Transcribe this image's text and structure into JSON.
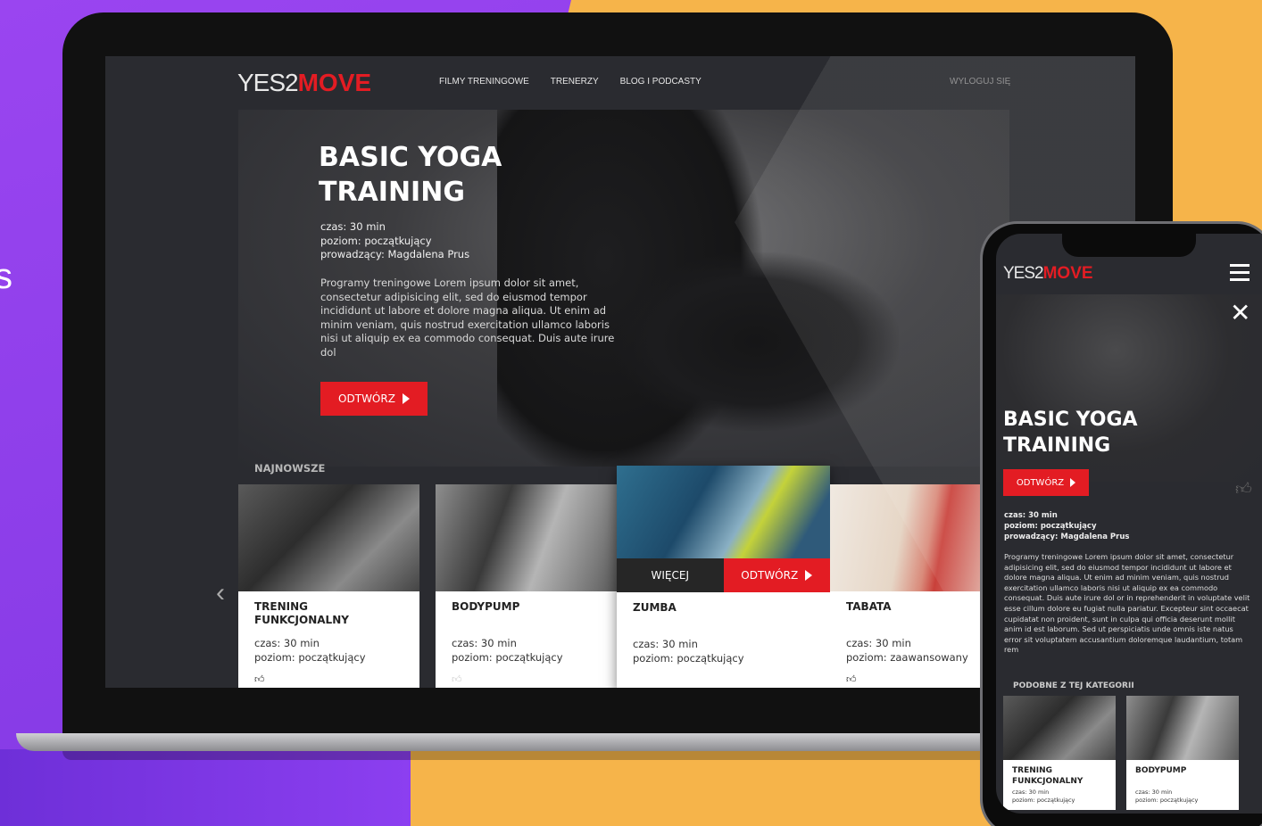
{
  "edge_letter": "s",
  "desktop": {
    "logo": {
      "main": "YES2",
      "accent": "MOVE"
    },
    "nav": [
      "FILMY TRENINGOWE",
      "TRENERZY",
      "BLOG I PODCASTY"
    ],
    "logout": "WYLOGUJ SIĘ",
    "hero": {
      "title_line1": "BASIC YOGA",
      "title_line2": "TRAINING",
      "meta": [
        "czas: 30 min",
        "poziom: początkujący",
        "prowadzący: Magdalena Prus"
      ],
      "description": "Programy treningowe Lorem ipsum dolor sit amet, consectetur adipisicing elit, sed do eiusmod tempor incididunt ut labore et dolore magna aliqua. Ut enim ad minim veniam, quis nostrud exercitation ullamco laboris nisi ut aliquip ex ea commodo consequat. Duis aute irure dol",
      "play_label": "ODTWÓRZ"
    },
    "section_label": "NAJNOWSZE",
    "cards": [
      {
        "title_line1": "TRENING",
        "title_line2": "FUNKCJONALNY",
        "time": "czas: 30 min",
        "level": "poziom: początkujący"
      },
      {
        "title_line1": "BODYPUMP",
        "title_line2": "",
        "time": "czas: 30 min",
        "level": "poziom: początkujący"
      },
      {
        "title_line1": "ZUMBA",
        "title_line2": "",
        "time": "czas: 30 min",
        "level": "poziom: początkujący",
        "more_label": "WIĘCEJ",
        "play_label": "ODTWÓRZ"
      },
      {
        "title_line1": "TABATA",
        "title_line2": "",
        "time": "czas: 30 min",
        "level": "poziom: zaawansowany"
      }
    ]
  },
  "mobile": {
    "logo": {
      "main": "YES2",
      "accent": "MOVE"
    },
    "hero": {
      "title_line1": "BASIC YOGA",
      "title_line2": "TRAINING",
      "play_label": "ODTWÓRZ",
      "meta": [
        "czas: 30 min",
        "poziom: początkujący",
        "prowadzący: Magdalena Prus"
      ],
      "description": "Programy treningowe Lorem ipsum dolor sit amet, consectetur adipisicing elit, sed do eiusmod tempor incididunt ut labore et dolore magna aliqua. Ut enim ad minim veniam, quis nostrud exercitation ullamco laboris nisi ut aliquip ex ea commodo consequat. Duis aute irure dol or in reprehenderit in voluptate velit esse cillum dolore eu fugiat nulla pariatur. Excepteur sint occaecat cupidatat non proident, sunt in culpa qui officia deserunt mollit anim id est laborum. Sed ut perspiciatis unde omnis iste natus error sit voluptatem accusantium doloremque laudantium, totam rem"
    },
    "section_label": "PODOBNE Z TEJ KATEGORII",
    "cards": [
      {
        "title_line1": "TRENING",
        "title_line2": "FUNKCJONALNY",
        "time": "czas: 30 min",
        "level": "poziom: początkujący"
      },
      {
        "title_line1": "BODYPUMP",
        "title_line2": "",
        "time": "czas: 30 min",
        "level": "poziom: początkujący"
      }
    ]
  },
  "colors": {
    "accent": "#e31c23",
    "purple": "#8c3ff0",
    "orange": "#f6b44a",
    "screen_bg": "#2a2b30"
  },
  "icons": [
    "play-icon",
    "chevron-left-icon",
    "thumbs-up-icon",
    "menu-icon",
    "close-icon"
  ]
}
